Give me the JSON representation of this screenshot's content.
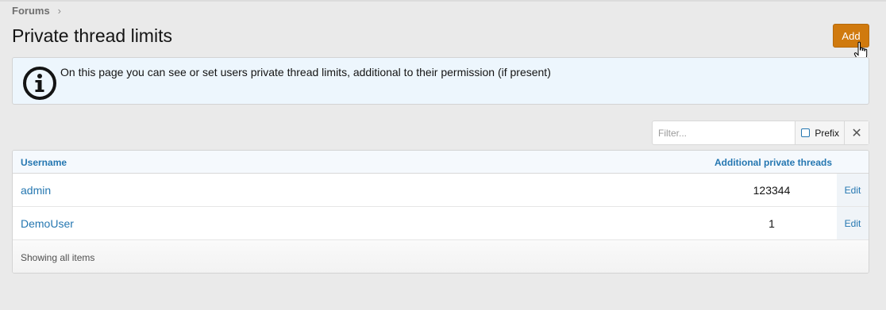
{
  "breadcrumb": {
    "item": "Forums",
    "separator": "›"
  },
  "page": {
    "title": "Private thread limits"
  },
  "header": {
    "add_label": "Add"
  },
  "info": {
    "text": "On this page you can see or set users private thread limits, additional to their permission (if present)"
  },
  "filter": {
    "placeholder": "Filter...",
    "prefix_label": "Prefix",
    "clear_symbol": "✕"
  },
  "table": {
    "columns": {
      "username": "Username",
      "additional": "Additional private threads"
    },
    "rows": [
      {
        "username": "admin",
        "value": "123344",
        "action": "Edit"
      },
      {
        "username": "DemoUser",
        "value": "1",
        "action": "Edit"
      }
    ],
    "footer": "Showing all items"
  },
  "colors": {
    "accent": "#2577b1",
    "add_button": "#d07a0e",
    "info_bg": "#edf6fd"
  }
}
